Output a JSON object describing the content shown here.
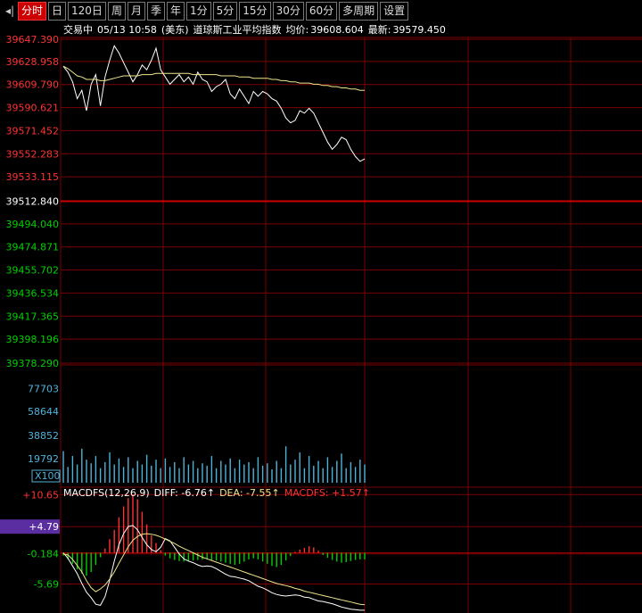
{
  "toolbar": {
    "tabs": [
      {
        "label": "分时",
        "active": true
      },
      {
        "label": "日",
        "active": false
      },
      {
        "label": "120日",
        "active": false
      },
      {
        "label": "周",
        "active": false
      },
      {
        "label": "月",
        "active": false
      },
      {
        "label": "季",
        "active": false
      },
      {
        "label": "年",
        "active": false
      },
      {
        "label": "1分",
        "active": false
      },
      {
        "label": "5分",
        "active": false
      },
      {
        "label": "15分",
        "active": false
      },
      {
        "label": "30分",
        "active": false
      },
      {
        "label": "60分",
        "active": false
      },
      {
        "label": "多周期",
        "active": false
      },
      {
        "label": "设置",
        "active": false
      }
    ]
  },
  "header": {
    "status": "交易中",
    "datetime": "05/13 10:58",
    "timezone": "(美东)",
    "instrument": "道琼斯工业平均指数",
    "avg_label": "均价:",
    "avg_value": "39608.604",
    "last_label": "最新:",
    "last_value": "39579.450"
  },
  "macd_header": {
    "name": "MACDFS(12,26,9)",
    "diff": "DIFF: -6.76↑",
    "dea": "DEA: -7.55↑",
    "macdfs": "MACDFS: +1.57↑"
  },
  "volume_multiplier": "X100",
  "colors": {
    "up": "#ff3232",
    "down": "#00d000",
    "grid": "#7a0000",
    "price_line": "#ffffff",
    "avg_line": "#f0e68c",
    "volume_bar": "#4fb3d9",
    "highlight": "#5a2da0"
  },
  "chart_data": [
    {
      "type": "line",
      "panel": "price",
      "ylim": [
        39378.29,
        39647.39
      ],
      "reference": 39512.84,
      "y_ticks": [
        "39647.390",
        "39628.958",
        "39609.790",
        "39590.621",
        "39571.452",
        "39552.283",
        "39533.115",
        "39512.840",
        "39494.040",
        "39474.871",
        "39455.702",
        "39436.534",
        "39417.365",
        "39398.196",
        "39378.290"
      ],
      "series": [
        {
          "values": [
            39625,
            39620,
            39612,
            39598,
            39605,
            39588,
            39610,
            39618,
            39592,
            39616,
            39630,
            39642,
            39636,
            39628,
            39620,
            39612,
            39618,
            39626,
            39622,
            39630,
            39640,
            39622,
            39616,
            39610,
            39614,
            39618,
            39612,
            39616,
            39610,
            39620,
            39614,
            39612,
            39604,
            39608,
            39610,
            39614,
            39602,
            39598,
            39606,
            39600,
            39594,
            39604,
            39600,
            39604,
            39602,
            39598,
            39596,
            39590,
            39582,
            39578,
            39580,
            39588,
            39586,
            39590,
            39586,
            39578,
            39570,
            39562,
            39556,
            39560,
            39566,
            39564,
            39556,
            39550,
            39546,
            39548
          ]
        },
        {
          "values": [
            39625,
            39623,
            39620,
            39617,
            39616,
            39614,
            39614,
            39614,
            39613,
            39613,
            39614,
            39615,
            39616,
            39617,
            39617,
            39617,
            39617,
            39618,
            39618,
            39618,
            39619,
            39619,
            39619,
            39619,
            39619,
            39619,
            39619,
            39619,
            39618,
            39618,
            39618,
            39618,
            39618,
            39618,
            39617,
            39617,
            39617,
            39617,
            39616,
            39616,
            39616,
            39615,
            39615,
            39615,
            39615,
            39614,
            39614,
            39613,
            39613,
            39612,
            39612,
            39611,
            39611,
            39611,
            39610,
            39610,
            39609,
            39609,
            39608,
            39608,
            39607,
            39607,
            39606,
            39606,
            39605,
            39605
          ]
        }
      ]
    },
    {
      "type": "bar",
      "panel": "volume",
      "ylim": [
        0,
        97000
      ],
      "y_ticks": [
        "77703",
        "58644",
        "38852",
        "19792"
      ],
      "values": [
        26000,
        13000,
        22000,
        15000,
        28000,
        19000,
        16000,
        22000,
        12000,
        17000,
        25000,
        15000,
        20000,
        13000,
        21000,
        12000,
        18000,
        15000,
        23000,
        14000,
        19000,
        12000,
        20000,
        13000,
        17000,
        12000,
        21000,
        15000,
        18000,
        12000,
        16000,
        14000,
        22000,
        12000,
        18000,
        15000,
        20000,
        12000,
        19000,
        15000,
        17000,
        12000,
        21000,
        14000,
        16000,
        11000,
        18000,
        12000,
        30000,
        15000,
        19000,
        25000,
        12000,
        22000,
        14000,
        18000,
        12000,
        21000,
        13000,
        18000,
        24000,
        12000,
        17000,
        13000,
        19000,
        15000
      ]
    },
    {
      "type": "bar",
      "panel": "macd",
      "ylim": [
        -11.0,
        12.0
      ],
      "y_ticks": [
        "+10.65",
        "+4.79",
        "-0.184",
        "-5.69"
      ],
      "highlight_tick": "+4.79",
      "histogram": [
        -0.5,
        -1.2,
        -2.0,
        -3.0,
        -3.8,
        -4.2,
        -3.5,
        -2.2,
        -0.8,
        0.8,
        2.5,
        4.2,
        6.5,
        8.5,
        10.0,
        10.7,
        9.8,
        7.5,
        5.2,
        3.2,
        1.8,
        0.5,
        -0.5,
        -1.0,
        -1.3,
        -1.5,
        -1.6,
        -1.5,
        -1.4,
        -1.3,
        -1.2,
        -1.2,
        -1.3,
        -1.4,
        -1.6,
        -1.8,
        -2.0,
        -2.2,
        -2.0,
        -1.6,
        -1.2,
        -1.0,
        -1.2,
        -1.6,
        -2.0,
        -2.4,
        -2.6,
        -2.2,
        -1.4,
        -0.6,
        0.2,
        0.6,
        0.9,
        1.2,
        1.0,
        0.4,
        -0.4,
        -0.9,
        -1.3,
        -1.6,
        -1.8,
        -1.7,
        -1.5,
        -1.3,
        -1.2,
        -1.2
      ],
      "series": [
        {
          "name": "DIFF",
          "values": [
            0,
            -1,
            -2.4,
            -3.8,
            -5.6,
            -7.2,
            -8.2,
            -9.4,
            -9.6,
            -8,
            -5,
            -1.5,
            1.5,
            3.5,
            4.8,
            5,
            4.2,
            2.8,
            1.5,
            0.6,
            0.2,
            1,
            2.6,
            2.2,
            1,
            -0.2,
            -1.1,
            -1.5,
            -1.8,
            -2.2,
            -2.5,
            -2.4,
            -2.5,
            -2.9,
            -3.4,
            -3.9,
            -4.3,
            -4.4,
            -4.6,
            -4.8,
            -5.1,
            -5.6,
            -6.1,
            -6.4,
            -6.8,
            -7.3,
            -7.6,
            -7.8,
            -7.9,
            -7.8,
            -7.7,
            -7.8,
            -8.1,
            -8.2,
            -8.5,
            -8.8,
            -8.9,
            -9.1,
            -9.3,
            -9.6,
            -9.9,
            -10.1,
            -10.3,
            -10.4,
            -10.5,
            -10.5
          ]
        },
        {
          "name": "DEA",
          "values": [
            -0.2,
            -0.4,
            -1.2,
            -2.3,
            -3.5,
            -5.1,
            -6.4,
            -7.1,
            -6.6,
            -5.9,
            -4.8,
            -3.5,
            -1.9,
            -0.4,
            1.1,
            2.3,
            3.0,
            3.4,
            3.5,
            3.4,
            3.2,
            2.9,
            2.5,
            2.1,
            1.7,
            1.2,
            0.8,
            0.4,
            0.0,
            -0.4,
            -0.8,
            -1.1,
            -1.4,
            -1.7,
            -2.0,
            -2.3,
            -2.6,
            -2.9,
            -3.2,
            -3.5,
            -3.8,
            -4.1,
            -4.4,
            -4.7,
            -5.0,
            -5.3,
            -5.6,
            -5.8,
            -6.0,
            -6.2,
            -6.5,
            -6.7,
            -7.0,
            -7.2,
            -7.4,
            -7.6,
            -7.8,
            -8.0,
            -8.2,
            -8.4,
            -8.6,
            -8.8,
            -9.0,
            -9.2,
            -9.4,
            -9.5
          ]
        }
      ]
    }
  ]
}
